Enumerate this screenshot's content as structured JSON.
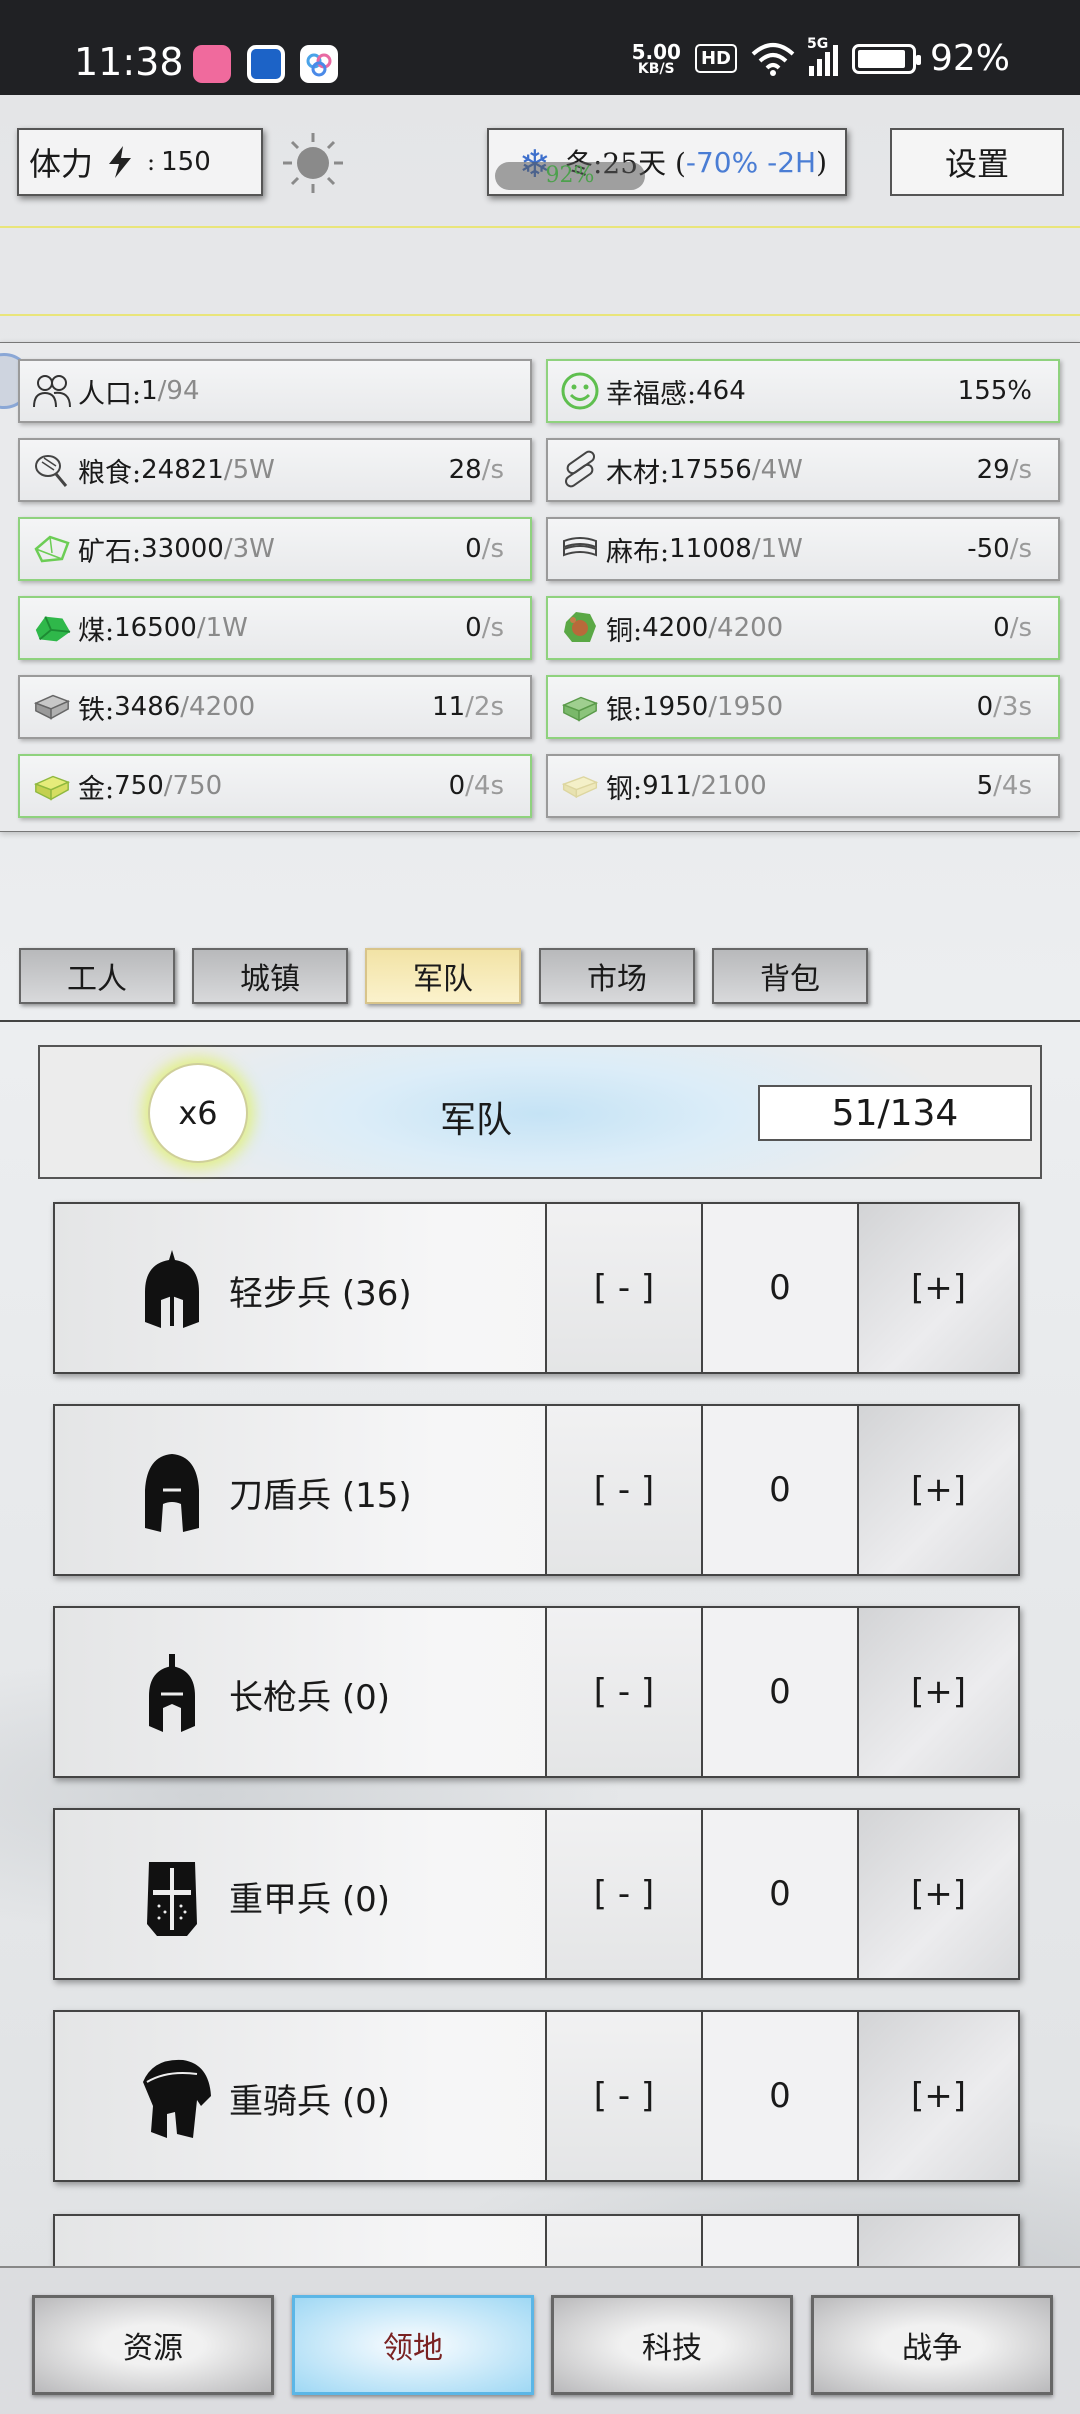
{
  "status_bar": {
    "time": "11:38",
    "net_speed": "5.00",
    "net_unit": "KB/S",
    "hd": "HD",
    "network": "5G",
    "battery": "92%"
  },
  "top": {
    "stamina_label": "体力",
    "stamina_value": "150",
    "season_text": "冬:25天 (",
    "season_effect": "-70% -2H",
    "season_close": ")",
    "season_overlay": "92%",
    "settings_label": "设置"
  },
  "resources": [
    {
      "name": "人口:",
      "value": "1",
      "cap": "/94",
      "rate": "",
      "rate_unit": "",
      "icon": "population-icon"
    },
    {
      "name": "幸福感:",
      "value": "464",
      "cap": "",
      "rate": "155%",
      "rate_unit": "",
      "icon": "smile-icon"
    },
    {
      "name": "粮食:",
      "value": "24821",
      "cap": "/5W",
      "rate": "28",
      "rate_unit": "/s",
      "icon": "food-icon"
    },
    {
      "name": "木材:",
      "value": "17556",
      "cap": "/4W",
      "rate": "29",
      "rate_unit": "/s",
      "icon": "wood-icon"
    },
    {
      "name": "矿石:",
      "value": "33000",
      "cap": "/3W",
      "rate": "0",
      "rate_unit": "/s",
      "icon": "ore-icon"
    },
    {
      "name": "麻布:",
      "value": "11008",
      "cap": "/1W",
      "rate": "-50",
      "rate_unit": "/s",
      "icon": "linen-icon"
    },
    {
      "name": "煤:",
      "value": "16500",
      "cap": "/1W",
      "rate": "0",
      "rate_unit": "/s",
      "icon": "coal-icon"
    },
    {
      "name": "铜:",
      "value": "4200",
      "cap": "/4200",
      "rate": "0",
      "rate_unit": "/s",
      "icon": "copper-icon"
    },
    {
      "name": "铁:",
      "value": "3486",
      "cap": "/4200",
      "rate": "11",
      "rate_unit": "/2s",
      "icon": "iron-icon"
    },
    {
      "name": "银:",
      "value": "1950",
      "cap": "/1950",
      "rate": "0",
      "rate_unit": "/3s",
      "icon": "silver-icon"
    },
    {
      "name": "金:",
      "value": "750",
      "cap": "/750",
      "rate": "0",
      "rate_unit": "/4s",
      "icon": "gold-icon"
    },
    {
      "name": "钢:",
      "value": "911",
      "cap": "/2100",
      "rate": "5",
      "rate_unit": "/4s",
      "icon": "steel-icon"
    }
  ],
  "tabs": [
    "工人",
    "城镇",
    "军队",
    "市场",
    "背包"
  ],
  "army": {
    "multiplier": "x6",
    "title": "军队",
    "count": "51/134",
    "minus_label": "[ - ]",
    "plus_label": "[+]",
    "units": [
      {
        "name": "轻步兵",
        "count": "(36)",
        "value": "0"
      },
      {
        "name": "刀盾兵",
        "count": "(15)",
        "value": "0"
      },
      {
        "name": "长枪兵",
        "count": "(0)",
        "value": "0"
      },
      {
        "name": "重甲兵",
        "count": "(0)",
        "value": "0"
      },
      {
        "name": "重骑兵",
        "count": "(0)",
        "value": "0"
      }
    ]
  },
  "bottom_nav": [
    "资源",
    "领地",
    "科技",
    "战争"
  ],
  "colors": {
    "active_tab": "#f2e3a6",
    "active_nav": "#9fd8f4",
    "green_border": "#8fd27e",
    "season_effect": "#4a7dd4"
  }
}
